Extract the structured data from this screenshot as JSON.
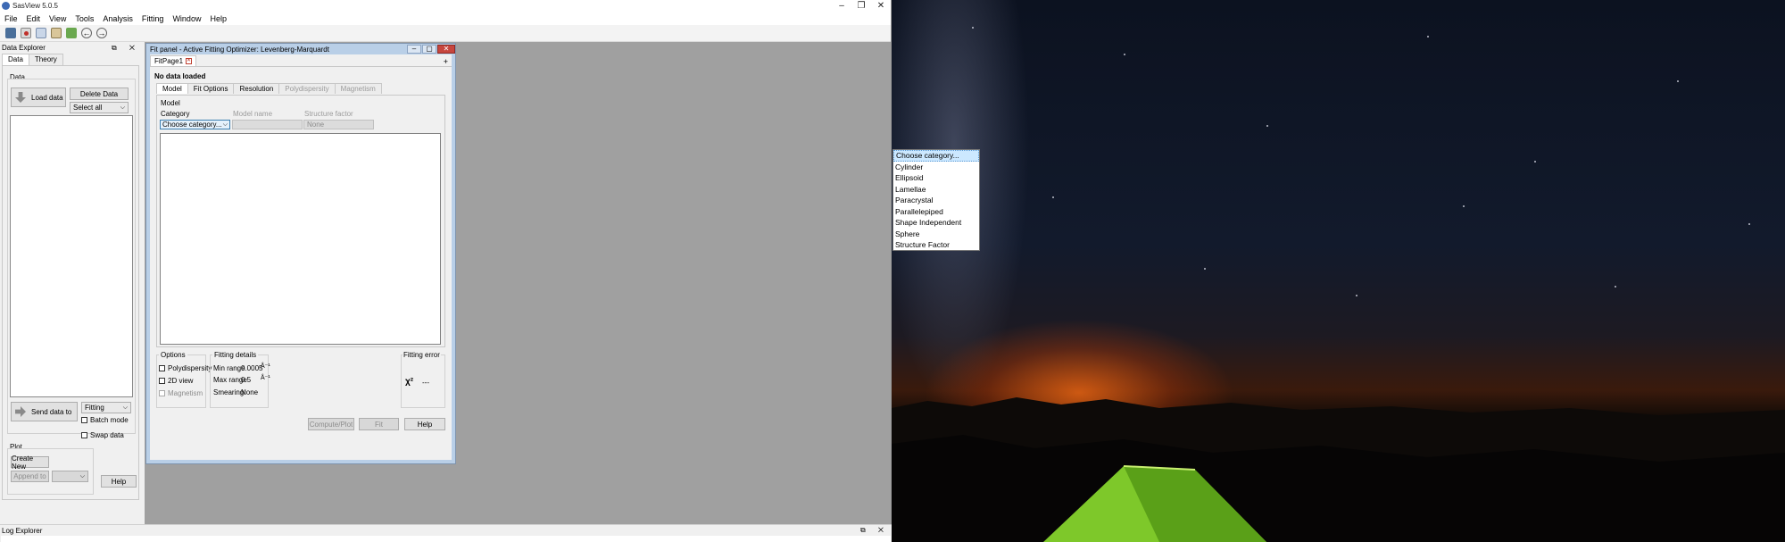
{
  "window": {
    "title": "SasView 5.0.5",
    "controls": {
      "minimize": "–",
      "restore": "❐",
      "close": "✕"
    }
  },
  "menubar": [
    "File",
    "Edit",
    "View",
    "Tools",
    "Analysis",
    "Fitting",
    "Window",
    "Help"
  ],
  "toolbar": {
    "icons": [
      "save-icon",
      "record-icon",
      "copy-icon",
      "paste-icon",
      "report-icon",
      "undo-icon",
      "redo-icon"
    ]
  },
  "data_explorer": {
    "title": "Data Explorer",
    "dock_controls": "⧉ ✕",
    "tabs": [
      "Data",
      "Theory"
    ],
    "data_group_label": "Data",
    "load_data_label": "Load data",
    "delete_data_label": "Delete Data",
    "select_all_value": "Select all",
    "send_data_label": "Send data to",
    "send_target_value": "Fitting",
    "batch_mode_label": "Batch mode",
    "swap_data_label": "Swap data",
    "plot_group_label": "Plot",
    "create_new_label": "Create New",
    "append_to_label": "Append to",
    "help_label": "Help"
  },
  "fit_panel": {
    "title": "Fit panel - Active Fitting Optimizer: Levenberg-Marquardt",
    "page_tab": "FitPage1",
    "add_tab": "+",
    "status_text": "No data loaded",
    "tabs": [
      "Model",
      "Fit Options",
      "Resolution",
      "Polydispersity",
      "Magnetism"
    ],
    "model_group_label": "Model",
    "category_label": "Category",
    "model_name_label": "Model name",
    "structure_factor_label": "Structure factor",
    "category_value": "Choose category...",
    "model_name_value": "",
    "structure_factor_value": "None",
    "options": {
      "label": "Options",
      "polydispersity": "Polydispersity",
      "view_2d": "2D view",
      "magnetism": "Magnetism"
    },
    "fitting_details": {
      "label": "Fitting details",
      "min_range_label": "Min range",
      "min_range_value": "0.0005",
      "max_range_label": "Max range",
      "max_range_value": "0.5",
      "unit": "Å⁻¹",
      "smearing_label": "Smearing:",
      "smearing_value": "None"
    },
    "fitting_error": {
      "label": "Fitting error",
      "chi_symbol": "χ²",
      "chi_value": "---"
    },
    "buttons": {
      "compute": "Compute/Plot",
      "fit": "Fit",
      "help": "Help"
    }
  },
  "category_dropdown": {
    "options": [
      "Choose category...",
      "Cylinder",
      "Ellipsoid",
      "Lamellae",
      "Paracrystal",
      "Parallelepiped",
      "Shape Independent",
      "Sphere",
      "Structure Factor"
    ],
    "selected_index": 0
  },
  "log_explorer": {
    "title": "Log Explorer",
    "dock_controls": "⧉ ✕"
  },
  "colors": {
    "accent_blue": "#3c7fb1",
    "fitpanel_border": "#b9cfe7",
    "mdi_background": "#a0a0a0",
    "close_red": "#c7463e"
  }
}
